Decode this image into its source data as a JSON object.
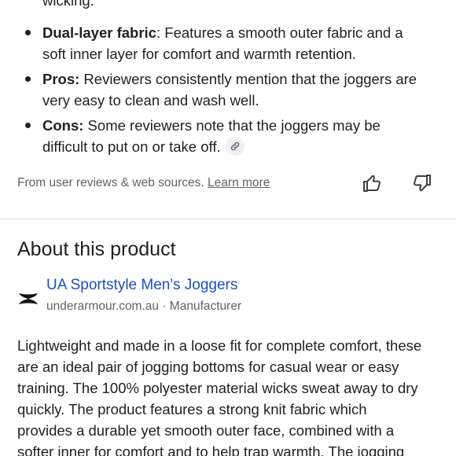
{
  "bullets": {
    "line0": "wicking.",
    "b1_bold": "Dual-layer fabric",
    "b1_rest": ": Features a smooth outer fabric and a",
    "b1_line2": "soft inner layer for comfort and warmth retention.",
    "b2_bold": "Pros:",
    "b2_rest": " Reviewers consistently mention that the joggers are",
    "b2_line2": "very easy to clean and wash well.",
    "b3_bold": "Cons:",
    "b3_rest": " Some reviewers note that the joggers may be",
    "b3_line2": "difficult to put on or take off."
  },
  "source": {
    "text": "From user reviews & web sources. ",
    "link": "Learn more"
  },
  "about": {
    "title": "About this product",
    "product_name": "UA Sportstyle Men's Joggers",
    "product_source": "underarmour.com.au · Manufacturer"
  },
  "description": [
    "Lightweight and made in a loose fit for complete comfort, these",
    "are an ideal pair of jogging bottoms for casual wear or easy",
    "training. The 100% polyester material wicks sweat away to dry",
    "quickly. The product features a strong knit fabric which",
    "provides a durable yet smooth outer face, combined with a",
    "softer inner for comfort and to help trap warmth. The jogging"
  ],
  "icons": {
    "link": "link-icon",
    "thumbs_up": "thumbs-up-icon",
    "thumbs_down": "thumbs-down-icon",
    "brand": "under-armour-logo"
  },
  "colors": {
    "link_blue": "#1a4fc4",
    "text": "#202124",
    "muted": "#5f6368"
  }
}
